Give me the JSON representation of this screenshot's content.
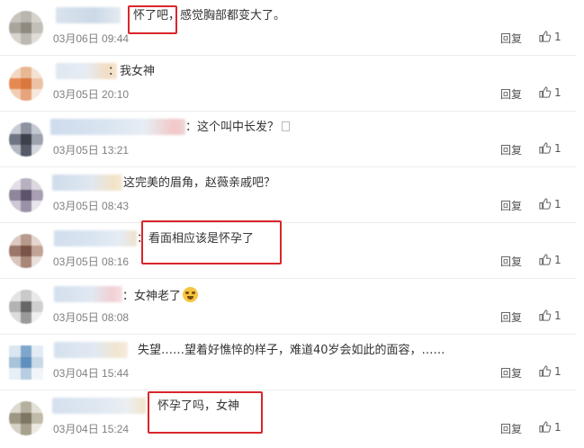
{
  "comments": [
    {
      "text": "怀了吧，感觉胸部都变大了。",
      "time": "03月06日 09:44",
      "reply_label": "回复",
      "like_count": "1"
    },
    {
      "text": "：我女神",
      "time": "03月05日 20:10",
      "reply_label": "回复",
      "like_count": "1"
    },
    {
      "text": "：这个叫中长发？",
      "time": "03月05日 13:21",
      "reply_label": "回复",
      "like_count": "1"
    },
    {
      "text": "这完美的眉角，赵薇亲戚吧？",
      "time": "03月05日 08:43",
      "reply_label": "回复",
      "like_count": "1"
    },
    {
      "text": "：看面相应该是怀孕了",
      "time": "03月05日 08:16",
      "reply_label": "回复",
      "like_count": "1"
    },
    {
      "text": "：女神老了",
      "time": "03月05日 08:08",
      "reply_label": "回复",
      "like_count": "1"
    },
    {
      "text": "失望……望着好憔悴的样子，难道40岁会如此的面容，……",
      "time": "03月04日 15:44",
      "reply_label": "回复",
      "like_count": "1"
    },
    {
      "text": "怀孕了吗，女神",
      "time": "03月04日 15:24",
      "reply_label": "回复",
      "like_count": "1"
    }
  ],
  "icons": {
    "like": "thumbs-up-icon",
    "emoji": "crying-laughing-emoji-icon",
    "broken_glyph": "missing-glyph-icon"
  },
  "colors": {
    "highlight": "#d8262b",
    "time": "#808080",
    "text": "#333333"
  }
}
